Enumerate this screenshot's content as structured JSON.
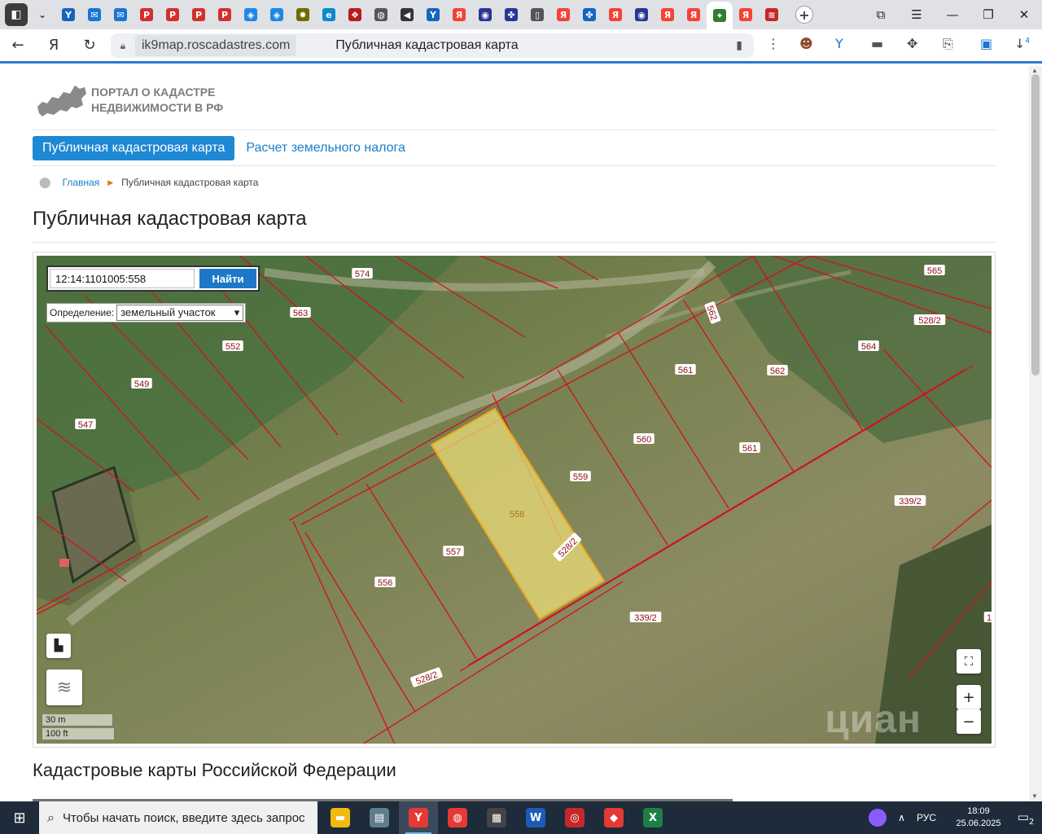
{
  "browser": {
    "tabs": [
      {
        "icon": "sound-tab-icon",
        "color": "#3c3c3c",
        "glyph": "◧"
      },
      {
        "icon": "tabs-dropdown-icon",
        "color": "",
        "glyph": "⌄"
      },
      {
        "icon": "yandex-browser-tab-icon",
        "color": "#1565c0",
        "glyph": "Y"
      },
      {
        "icon": "mail-tab-icon",
        "color": "#1976d2",
        "glyph": "✉"
      },
      {
        "icon": "mail-tab-icon",
        "color": "#1976d2",
        "glyph": "✉"
      },
      {
        "icon": "pdf-tab-icon",
        "color": "#d32f2f",
        "glyph": "P"
      },
      {
        "icon": "pdf-tab-icon",
        "color": "#d32f2f",
        "glyph": "P"
      },
      {
        "icon": "pdf-tab-icon",
        "color": "#d32f2f",
        "glyph": "P"
      },
      {
        "icon": "pdf-tab-icon",
        "color": "#d32f2f",
        "glyph": "P"
      },
      {
        "icon": "gov-tab-icon",
        "color": "#1e88e5",
        "glyph": "◈"
      },
      {
        "icon": "gov-tab-icon",
        "color": "#1e88e5",
        "glyph": "◈"
      },
      {
        "icon": "emblem-tab-icon",
        "color": "#6d6d00",
        "glyph": "✸"
      },
      {
        "icon": "edge-tab-icon",
        "color": "#0c8ad0",
        "glyph": "e"
      },
      {
        "icon": "ornament-tab-icon",
        "color": "#b71c1c",
        "glyph": "❖"
      },
      {
        "icon": "globe-tab-icon",
        "color": "#555",
        "glyph": "◍"
      },
      {
        "icon": "audio-tab-icon",
        "color": "#333",
        "glyph": "◀"
      },
      {
        "icon": "yandex-browser-tab-icon",
        "color": "#1565c0",
        "glyph": "Y"
      },
      {
        "icon": "yandex-tab-icon",
        "color": "#f44336",
        "glyph": "Я"
      },
      {
        "icon": "emblem-tab-icon",
        "color": "#283593",
        "glyph": "◉"
      },
      {
        "icon": "rosreestr-tab-icon",
        "color": "#283593",
        "glyph": "✤"
      },
      {
        "icon": "document-tab-icon",
        "color": "#555",
        "glyph": "▯"
      },
      {
        "icon": "yandex-tab-icon",
        "color": "#f44336",
        "glyph": "Я"
      },
      {
        "icon": "rosreestr-tab-icon",
        "color": "#1565c0",
        "glyph": "✤"
      },
      {
        "icon": "yandex-tab-icon",
        "color": "#f44336",
        "glyph": "Я"
      },
      {
        "icon": "emblem-tab-icon",
        "color": "#283593",
        "glyph": "◉"
      },
      {
        "icon": "yandex-tab-icon",
        "color": "#f44336",
        "glyph": "Я"
      },
      {
        "icon": "yandex-tab-icon",
        "color": "#f44336",
        "glyph": "Я"
      },
      {
        "icon": "map-tab-icon",
        "color": "#2e7d32",
        "glyph": "✦",
        "active": true
      },
      {
        "icon": "yandex-tab-icon",
        "color": "#f44336",
        "glyph": "Я"
      },
      {
        "icon": "music-tab-icon",
        "color": "#c62828",
        "glyph": "≋"
      },
      {
        "icon": "new-tab-icon",
        "color": "",
        "glyph": "+"
      }
    ],
    "address": {
      "host": "ik9map.roscadastres.com",
      "title": "Публичная кадастровая карта"
    },
    "downloads_count": "4"
  },
  "page": {
    "logo_line1": "ПОРТАЛ О КАДАСТРЕ",
    "logo_line2": "НЕДВИЖИМОСТИ В РФ",
    "nav": {
      "active": "Публичная кадастровая карта",
      "link": "Расчет земельного налога"
    },
    "breadcrumb": {
      "home": "Главная",
      "current": "Публичная кадастровая карта"
    },
    "heading": "Публичная кадастровая карта",
    "subheading": "Кадастровые карты Российской Федерации"
  },
  "map": {
    "search_value": "12:14:1101005:558",
    "search_button": "Найти",
    "definition_label": "Определение:",
    "definition_value": "земельный участок",
    "scale_m": "30 m",
    "scale_ft": "100 ft",
    "watermark": "циан",
    "zoom_in": "+",
    "zoom_out": "−",
    "selected_parcel": "558",
    "parcel_labels": [
      "574",
      "565",
      "563",
      "562",
      "528/2",
      "552",
      "564",
      "549",
      "561",
      "562",
      "547",
      "560",
      "561",
      "559",
      "339/2",
      "558",
      "528/2",
      "557",
      "556",
      "339/2",
      "528/2",
      "1"
    ],
    "colors": {
      "boundary": "#d1121a",
      "selected_fill": "#f2e27a",
      "selected_stroke": "#f0a81a"
    }
  },
  "taskbar": {
    "search_placeholder": "Чтобы начать поиск, введите здесь запрос",
    "lang": "РУС",
    "time": "18:09",
    "date": "25.06.2025",
    "notifications": "2",
    "apps": [
      {
        "icon": "file-explorer-icon",
        "color": "#f2b90f",
        "glyph": "▬",
        "active": false
      },
      {
        "icon": "hdd-app-icon",
        "color": "#607d8b",
        "glyph": "▤",
        "active": false
      },
      {
        "icon": "yandex-browser-icon",
        "color": "#e53935",
        "glyph": "Y",
        "active": true
      },
      {
        "icon": "app-red-swirl-icon",
        "color": "#e53935",
        "glyph": "◍",
        "active": false
      },
      {
        "icon": "calculator-icon",
        "color": "#444",
        "glyph": "▦",
        "active": false
      },
      {
        "icon": "word-icon",
        "color": "#1e5bb8",
        "glyph": "W",
        "active": false
      },
      {
        "icon": "app-circle-icon",
        "color": "#c62828",
        "glyph": "◎",
        "active": false
      },
      {
        "icon": "anydesk-icon",
        "color": "#e53935",
        "glyph": "◆",
        "active": false
      },
      {
        "icon": "excel-icon",
        "color": "#1e7e45",
        "glyph": "X",
        "active": false
      }
    ]
  }
}
